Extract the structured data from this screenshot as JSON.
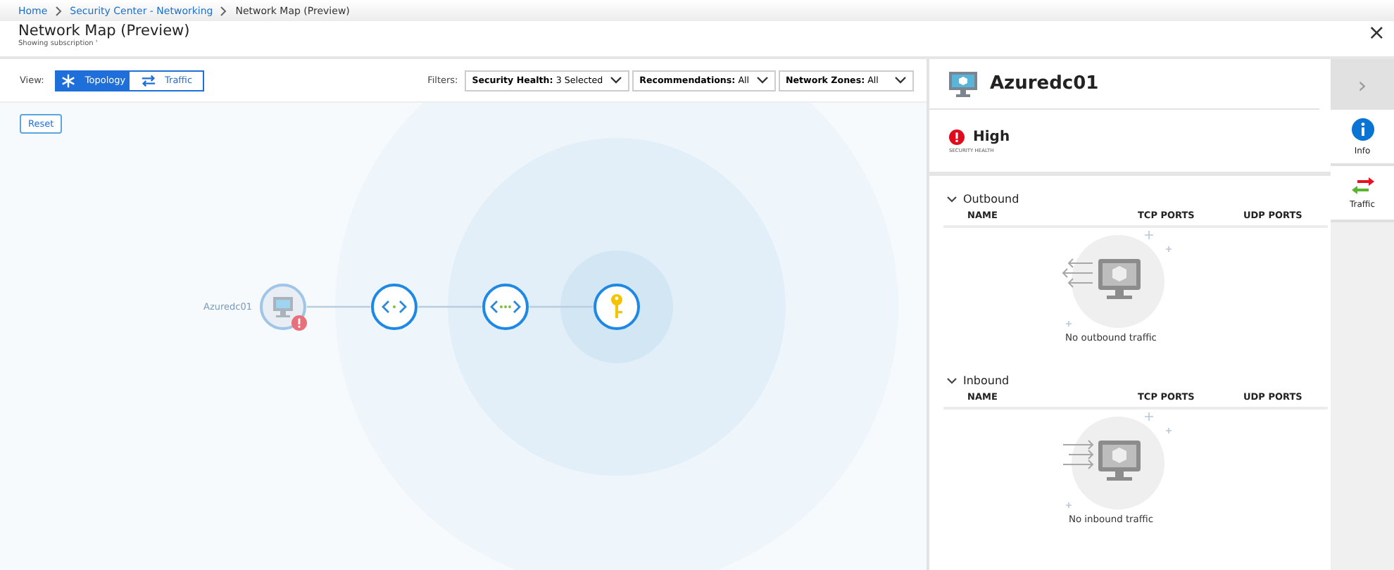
{
  "breadcrumb": [
    {
      "label": "Home",
      "link": true
    },
    {
      "label": "Security Center - Networking",
      "link": true
    },
    {
      "label": "Network Map (Preview)",
      "link": false
    }
  ],
  "window": {
    "title": "Network Map (Preview)",
    "subtitle": "Showing subscription '",
    "close": "×"
  },
  "view": {
    "label": "View:",
    "options": [
      {
        "label": "Topology",
        "kind": "topology",
        "selected": true
      },
      {
        "label": "Traffic",
        "kind": "traffic",
        "selected": false
      }
    ]
  },
  "filters": {
    "label": "Filters:",
    "items": [
      {
        "name": "Security Health:",
        "value": "3 Selected"
      },
      {
        "name": "Recommendations:",
        "value": "All"
      },
      {
        "name": "Network Zones:",
        "value": "All"
      }
    ]
  },
  "reset": "Reset",
  "map": {
    "nodes": [
      {
        "kind": "vm",
        "label": "Azuredc01",
        "alert": true
      },
      {
        "kind": "subnet"
      },
      {
        "kind": "vnet"
      },
      {
        "kind": "key"
      }
    ]
  },
  "details": {
    "title": "Azuredc01",
    "health": "High",
    "health_caption": "SECURITY HEALTH",
    "sections": [
      {
        "kind": "outbound",
        "title": "Outbound",
        "expanded": true,
        "columns": [
          "NAME",
          "TCP PORTS",
          "UDP PORTS"
        ],
        "empty": "No outbound traffic"
      },
      {
        "kind": "inbound",
        "title": "Inbound",
        "expanded": true,
        "columns": [
          "NAME",
          "TCP PORTS",
          "UDP PORTS"
        ],
        "empty": "No inbound traffic"
      }
    ]
  },
  "rail": {
    "collapse": "›",
    "items": [
      {
        "kind": "info",
        "label": "Info"
      },
      {
        "kind": "traffic",
        "label": "Traffic"
      }
    ]
  }
}
